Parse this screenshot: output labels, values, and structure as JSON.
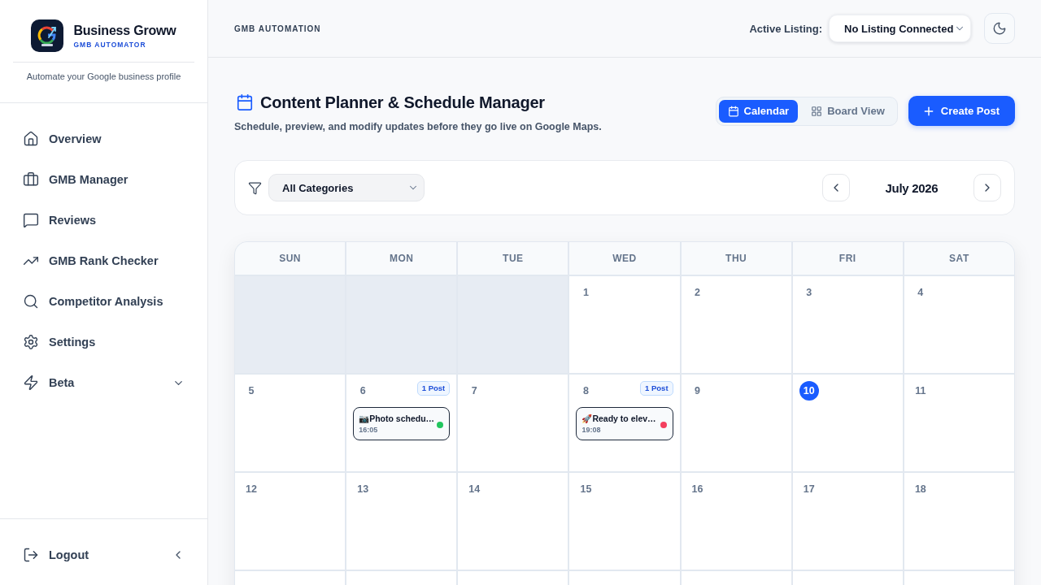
{
  "sidebar": {
    "brand": {
      "name": "Business Groww",
      "tagline": "GMB AUTOMATOR"
    },
    "description": "Automate your Google business profile",
    "nav": [
      {
        "label": "Overview",
        "kind": "link"
      },
      {
        "label": "GMB Manager",
        "kind": "link"
      },
      {
        "label": "Reviews",
        "kind": "link"
      },
      {
        "label": "GMB Rank Checker",
        "kind": "link"
      },
      {
        "label": "Competitor Analysis",
        "kind": "link"
      },
      {
        "label": "Settings",
        "kind": "link"
      },
      {
        "label": "Beta",
        "kind": "group",
        "expanded": false
      }
    ],
    "logout": "Logout"
  },
  "header": {
    "section": "GMB AUTOMATION",
    "listing_label": "Active Listing:",
    "listing_select": {
      "value": "No Listing Connected"
    }
  },
  "page": {
    "title": "Content Planner & Schedule Manager",
    "subtitle": "Schedule, preview, and modify updates before they go live on Google Maps.",
    "views": [
      {
        "label": "Calendar",
        "selected": true
      },
      {
        "label": "Board View",
        "selected": false
      }
    ],
    "create_button": "Create Post"
  },
  "filters": {
    "category_select": {
      "value": "All Categories"
    },
    "month": "July 2026"
  },
  "calendar": {
    "weekdays": [
      "SUN",
      "MON",
      "TUE",
      "WED",
      "THU",
      "FRI",
      "SAT"
    ],
    "weeks": [
      [
        {
          "kind": "blank"
        },
        {
          "kind": "blank"
        },
        {
          "kind": "blank"
        },
        {
          "kind": "day",
          "day": "1",
          "today": false
        },
        {
          "kind": "day",
          "day": "2",
          "today": false
        },
        {
          "kind": "day",
          "day": "3",
          "today": false
        },
        {
          "kind": "day",
          "day": "4",
          "today": false
        }
      ],
      [
        {
          "kind": "day",
          "day": "5",
          "today": false
        },
        {
          "kind": "day",
          "day": "6",
          "today": false,
          "badge": "1 Post",
          "posts": [
            {
              "title": "📷Photo schedu…",
              "time": "16:05",
              "color": "#22c55e"
            }
          ]
        },
        {
          "kind": "day",
          "day": "7",
          "today": false
        },
        {
          "kind": "day",
          "day": "8",
          "today": false,
          "badge": "1 Post",
          "posts": [
            {
              "title": "🚀Ready to elev…",
              "time": "19:08",
              "color": "#f43f5e"
            }
          ]
        },
        {
          "kind": "day",
          "day": "9",
          "today": false
        },
        {
          "kind": "day",
          "day": "10",
          "today": true
        },
        {
          "kind": "day",
          "day": "11",
          "today": false
        }
      ],
      [
        {
          "kind": "day",
          "day": "12",
          "today": false
        },
        {
          "kind": "day",
          "day": "13",
          "today": false
        },
        {
          "kind": "day",
          "day": "14",
          "today": false
        },
        {
          "kind": "day",
          "day": "15",
          "today": false
        },
        {
          "kind": "day",
          "day": "16",
          "today": false
        },
        {
          "kind": "day",
          "day": "17",
          "today": false
        },
        {
          "kind": "day",
          "day": "18",
          "today": false
        }
      ],
      [
        {
          "kind": "day"
        },
        {
          "kind": "day"
        },
        {
          "kind": "day"
        },
        {
          "kind": "day"
        },
        {
          "kind": "day"
        },
        {
          "kind": "day"
        },
        {
          "kind": "day"
        }
      ]
    ]
  }
}
